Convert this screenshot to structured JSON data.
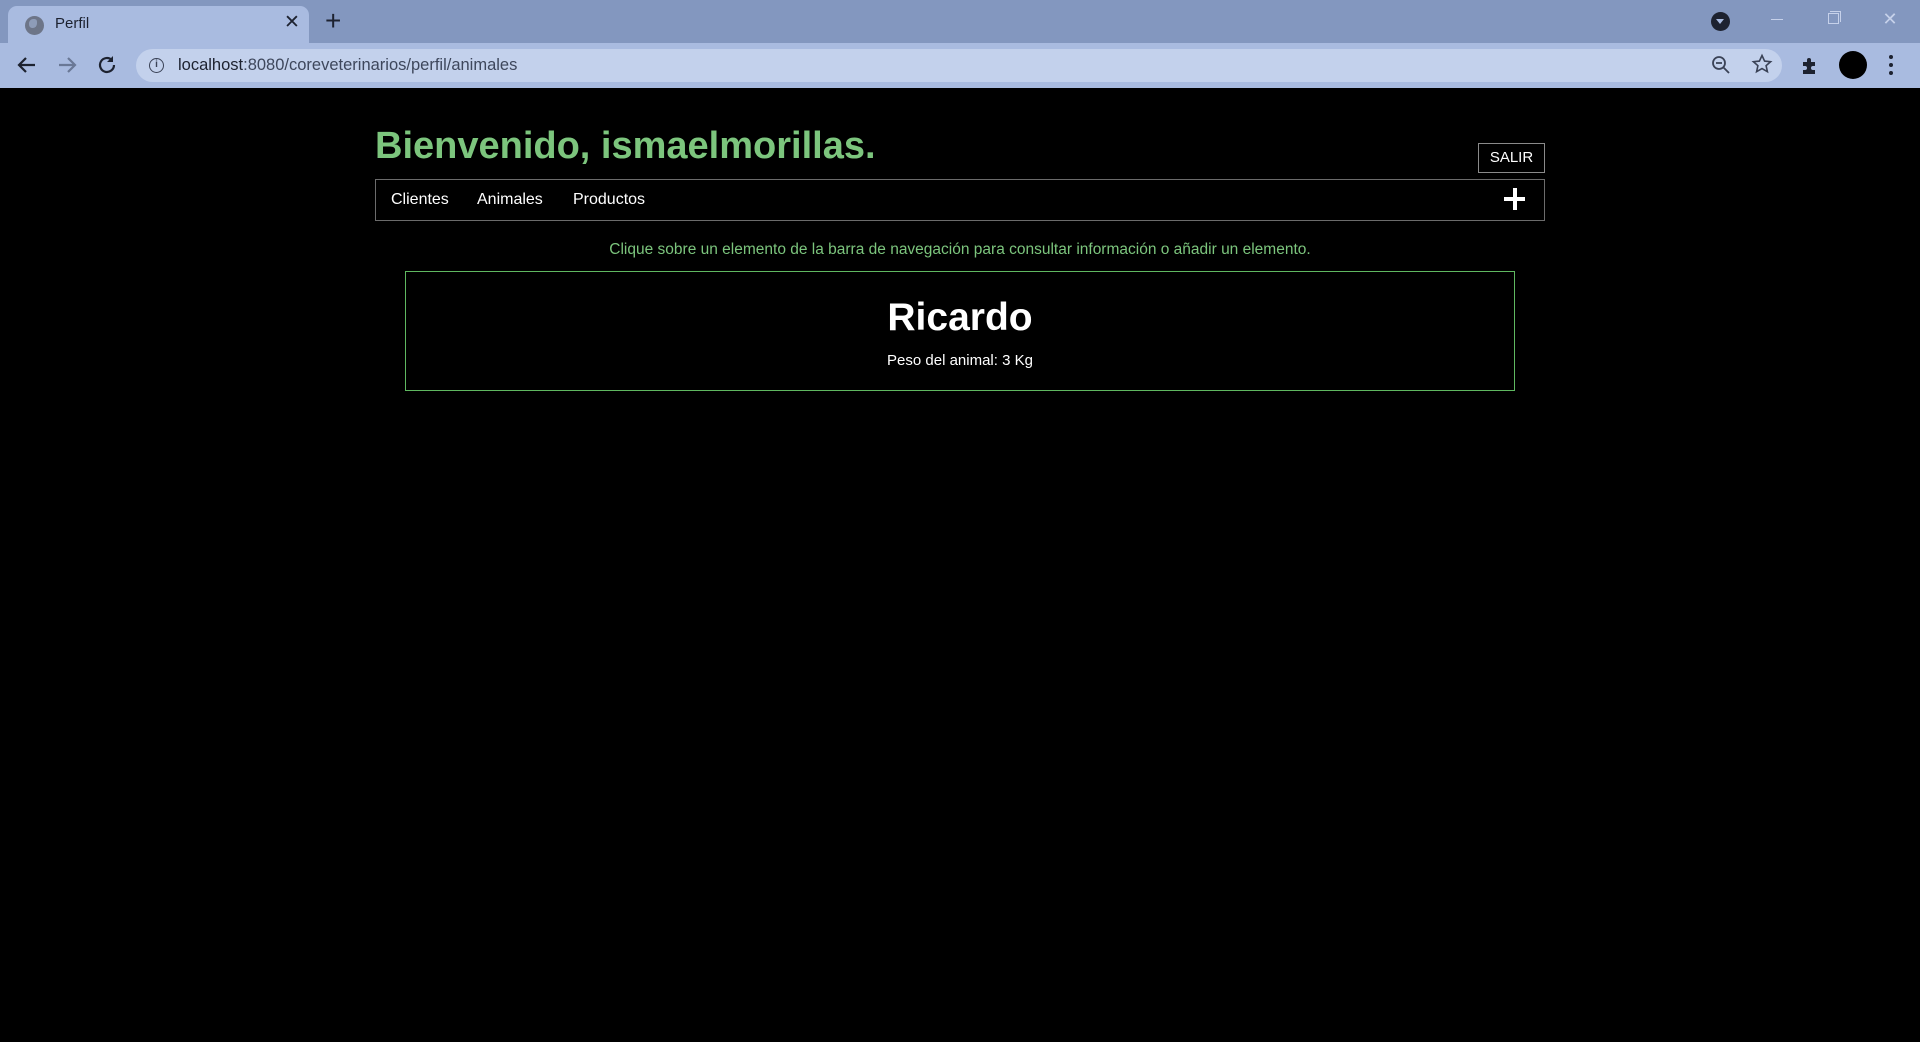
{
  "browser": {
    "tab_title": "Perfil",
    "tab_close": "✕",
    "new_tab": "+",
    "url_host": "localhost",
    "url_rest": ":8080/coreveterinarios/perfil/animales",
    "icons": {
      "favicon": "globe-icon",
      "back": "arrow-left-icon",
      "forward": "arrow-right-icon",
      "reload": "reload-icon",
      "site_info": "info-icon",
      "zoom": "zoom-out-icon",
      "bookmark": "star-icon",
      "extensions": "puzzle-icon",
      "profile": "avatar-icon",
      "menu": "kebab-menu-icon"
    },
    "chrome_color": "#a9bbe0"
  },
  "header": {
    "welcome": "Bienvenido, ismaelmorillas.",
    "logout_label": "SALIR",
    "accent_color": "#7cc57d"
  },
  "nav": {
    "items": [
      {
        "label": "Clientes"
      },
      {
        "label": "Animales"
      },
      {
        "label": "Productos"
      }
    ],
    "add_icon": "plus-icon"
  },
  "main": {
    "hint": "Clique sobre un elemento de la barra de navegación para consultar información o añadir un elemento.",
    "animals": [
      {
        "name": "Ricardo",
        "detail": "Peso del animal: 3 Kg"
      }
    ]
  }
}
